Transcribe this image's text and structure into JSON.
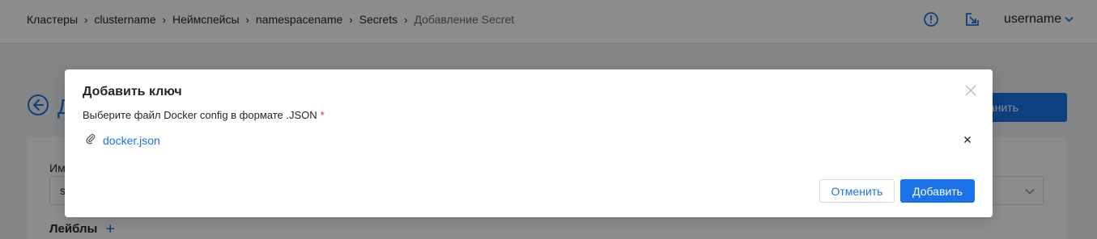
{
  "header": {
    "breadcrumb": [
      "Кластеры",
      "clustername",
      "Неймспейсы",
      "namespacename",
      "Secrets",
      "Добавление Secret"
    ],
    "separator": "›",
    "username": "username",
    "icons": [
      "alert-circle-icon",
      "open-external-icon",
      "chevron-down-icon"
    ]
  },
  "page": {
    "title": "Д",
    "save_button_label": "анить",
    "name_label": "Им",
    "name_input_value": "s",
    "labels_heading": "Лейблы",
    "labels_add": "+"
  },
  "modal": {
    "title": "Добавить ключ",
    "field_label": "Выберите файл Docker config в формате .JSON",
    "required_mark": "*",
    "file_name": "docker.json",
    "cancel_label": "Отменить",
    "submit_label": "Добавить"
  },
  "colors": {
    "accent": "#1a73e8",
    "required": "#e0282e",
    "overlay": "rgba(0,0,0,0.45)"
  }
}
